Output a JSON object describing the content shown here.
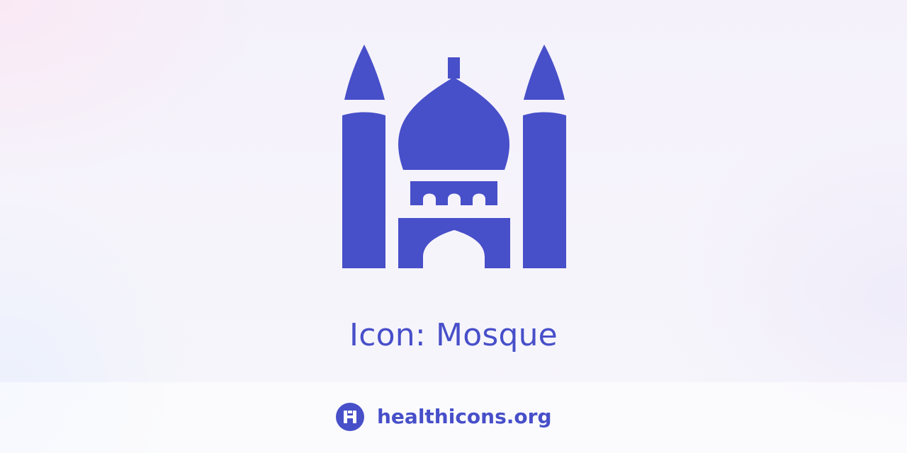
{
  "hero": {
    "icon_name": "mosque-icon",
    "title": "Icon: Mosque",
    "accent_color": "#474fc9"
  },
  "footer": {
    "logo_icon": "healthicons-logo-icon",
    "site_link": "healthicons.org"
  }
}
